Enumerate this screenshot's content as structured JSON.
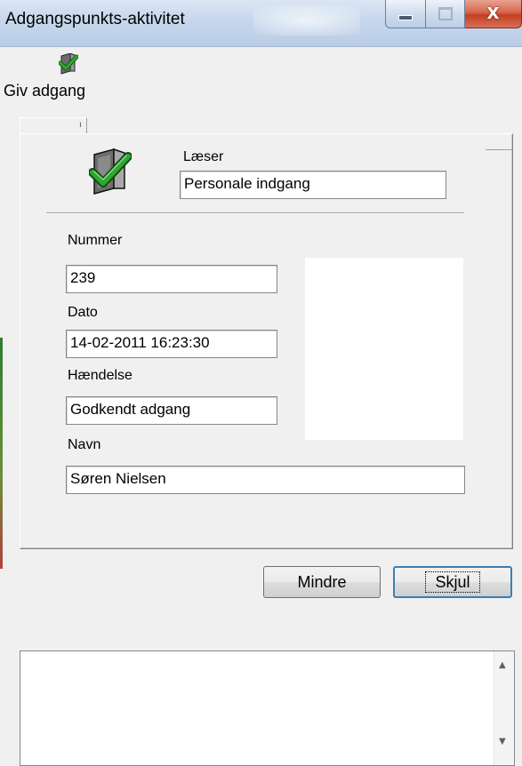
{
  "window": {
    "title": "Adgangspunkts-aktivitet",
    "close_glyph": "X"
  },
  "toolbar": {
    "give_access_label": "Giv adgang",
    "give_access_icon": "door-check-icon"
  },
  "reader": {
    "label": "Læser",
    "value": "Personale indgang",
    "icon": "door-check-icon"
  },
  "fields": {
    "number_label": "Nummer",
    "number_value": "239",
    "date_label": "Dato",
    "date_value": "14-02-2011 16:23:30",
    "event_label": "Hændelse",
    "event_value": "Godkendt adgang",
    "name_label": "Navn",
    "name_value": "Søren Nielsen"
  },
  "buttons": {
    "less_label": "Mindre",
    "hide_label": "Skjul"
  },
  "colors": {
    "check_green": "#2fa82f",
    "door_gray": "#6d6d6d",
    "close_red": "#c3401f"
  }
}
